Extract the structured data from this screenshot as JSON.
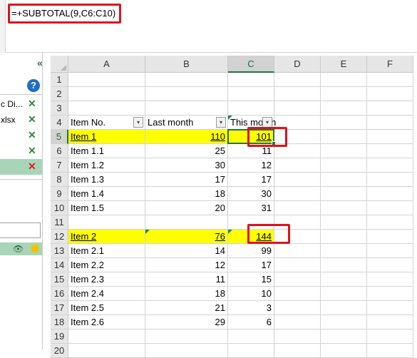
{
  "formula_bar": {
    "text": "=+SUBTOTAL(9,C6:C10)"
  },
  "left_pane": {
    "collapse_symbol": "«",
    "help_symbol": "?",
    "items": [
      {
        "label": "c Di...",
        "mark": "✕",
        "status": "ok"
      },
      {
        "label": "xlsx",
        "mark": "✕",
        "status": "ok"
      },
      {
        "label": "",
        "mark": "✕",
        "status": "ok"
      },
      {
        "label": "",
        "mark": "✕",
        "status": "ok"
      },
      {
        "label": "",
        "mark": "✕",
        "status": "error"
      }
    ],
    "eye_symbol": "👁"
  },
  "sheet": {
    "columns": [
      "A",
      "B",
      "C",
      "D",
      "E",
      "F"
    ],
    "active_column": "C",
    "active_row": "5",
    "rows": [
      {
        "num": "1",
        "a": "",
        "b": "",
        "c": ""
      },
      {
        "num": "2",
        "a": "",
        "b": "",
        "c": ""
      },
      {
        "num": "3",
        "a": "",
        "b": "",
        "c": ""
      },
      {
        "num": "4",
        "a": "Item No.",
        "b": "Last month",
        "c": "This month",
        "header": true
      },
      {
        "num": "5",
        "a": "Item 1",
        "b": "110",
        "c": "101",
        "yellow": true,
        "underline": true
      },
      {
        "num": "6",
        "a": "Item 1.1",
        "b": "25",
        "c": "11"
      },
      {
        "num": "7",
        "a": "Item 1.2",
        "b": "30",
        "c": "12"
      },
      {
        "num": "8",
        "a": "Item 1.3",
        "b": "17",
        "c": "17"
      },
      {
        "num": "9",
        "a": "Item 1.4",
        "b": "18",
        "c": "30"
      },
      {
        "num": "10",
        "a": "Item 1.5",
        "b": "20",
        "c": "31"
      },
      {
        "num": "11",
        "a": "",
        "b": "",
        "c": ""
      },
      {
        "num": "12",
        "a": "Item 2",
        "b": "76",
        "c": "144",
        "yellow": true,
        "underline": true
      },
      {
        "num": "13",
        "a": "Item 2.1",
        "b": "14",
        "c": "99"
      },
      {
        "num": "14",
        "a": "Item 2.2",
        "b": "12",
        "c": "17"
      },
      {
        "num": "15",
        "a": "Item 2.3",
        "b": "11",
        "c": "15"
      },
      {
        "num": "16",
        "a": "Item 2.4",
        "b": "18",
        "c": "10"
      },
      {
        "num": "17",
        "a": "Item 2.5",
        "b": "21",
        "c": "3"
      },
      {
        "num": "18",
        "a": "Item 2.6",
        "b": "29",
        "c": "6"
      },
      {
        "num": "19",
        "a": "",
        "b": "",
        "c": ""
      },
      {
        "num": "20",
        "a": "",
        "b": "",
        "c": ""
      }
    ],
    "filter_symbol": "▾"
  },
  "colors": {
    "highlight": "#ffff00",
    "annotation_red": "#e0111a",
    "selection_green": "#217346"
  }
}
